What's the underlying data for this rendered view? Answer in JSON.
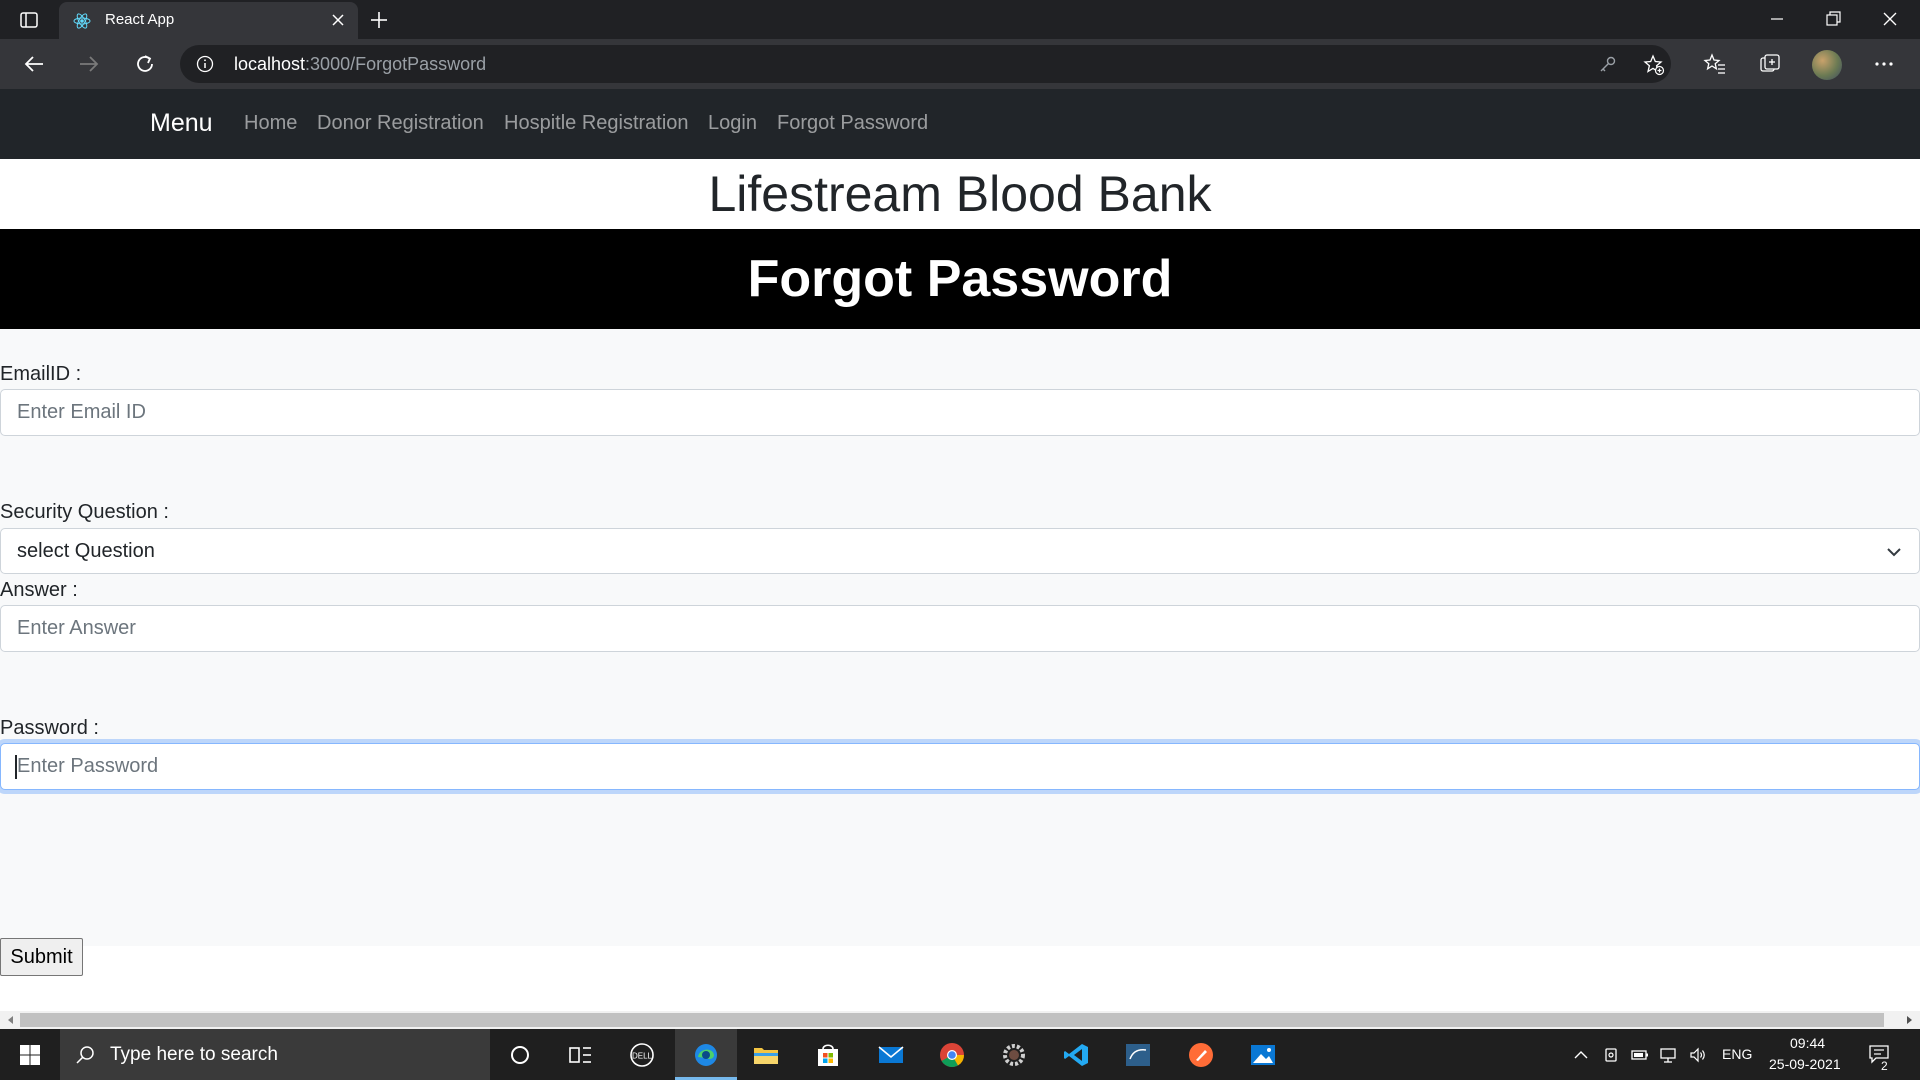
{
  "browser": {
    "tab_title": "React App",
    "url_host": "localhost",
    "url_rest": ":3000/ForgotPassword"
  },
  "navbar": {
    "brand": "Menu",
    "links": [
      "Home",
      "Donor Registration",
      "Hospitle Registration",
      "Login",
      "Forgot Password"
    ]
  },
  "page": {
    "site_title": "Lifestream Blood Bank",
    "heading": "Forgot Password"
  },
  "form": {
    "email_label": "EmailID :",
    "email_placeholder": "Enter Email ID",
    "question_label": "Security Question :",
    "question_value": "select Question",
    "answer_label": "Answer :",
    "answer_placeholder": "Enter Answer",
    "password_label": "Password :",
    "password_placeholder": "Enter Password",
    "submit_label": "Submit"
  },
  "taskbar": {
    "search_placeholder": "Type here to search",
    "language": "ENG",
    "time": "09:44",
    "date": "25-09-2021",
    "notification_count": "2"
  },
  "colors": {
    "navbar_bg": "#212529",
    "banner_bg": "#000000",
    "form_bg": "#f8f9fa",
    "focus_ring": "#86b7fe"
  }
}
